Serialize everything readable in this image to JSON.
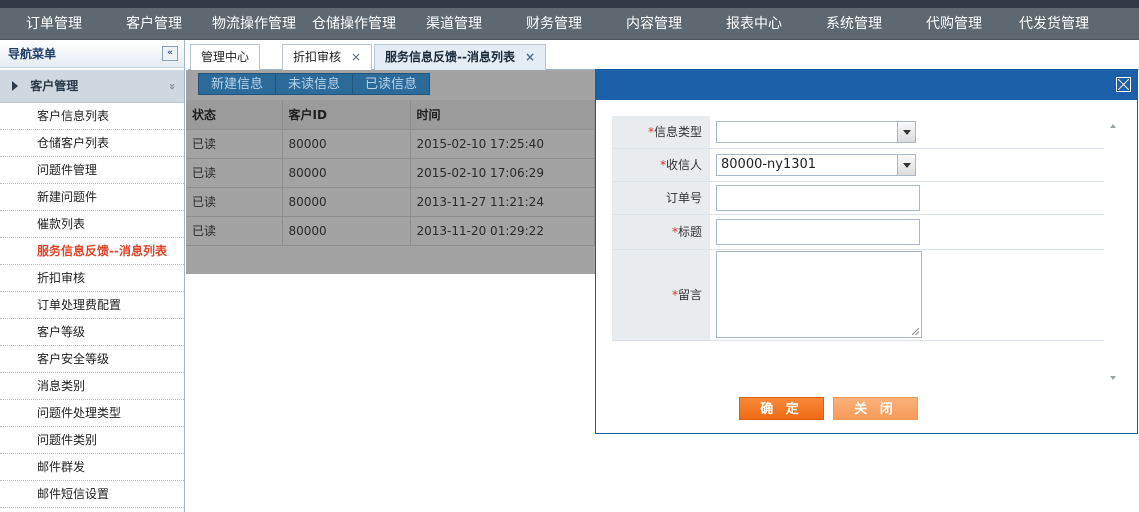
{
  "topnav": [
    "订单管理",
    "客户管理",
    "物流操作管理",
    "仓储操作管理",
    "渠道管理",
    "财务管理",
    "内容管理",
    "报表中心",
    "系统管理",
    "代购管理",
    "代发货管理"
  ],
  "sidebar": {
    "title": "导航菜单",
    "collapse_glyph": "«",
    "section": "客户管理",
    "section_chevron": "»",
    "items": [
      "客户信息列表",
      "仓储客户列表",
      "问题件管理",
      "新建问题件",
      "催款列表",
      "服务信息反馈--消息列表",
      "折扣审核",
      "订单处理费配置",
      "客户等级",
      "客户安全等级",
      "消息类别",
      "问题件处理类型",
      "问题件类别",
      "邮件群发",
      "邮件短信设置"
    ],
    "active_index": 5
  },
  "tabs": [
    {
      "label": "管理中心",
      "closable": false
    },
    {
      "label": "折扣审核",
      "closable": true
    },
    {
      "label": "服务信息反馈--消息列表",
      "closable": true,
      "active": true
    }
  ],
  "tab_close_glyph": "×",
  "toolbar": [
    "新建信息",
    "未读信息",
    "已读信息"
  ],
  "grid": {
    "columns": [
      "状态",
      "客户ID",
      "时间"
    ],
    "rows": [
      [
        "已读",
        "80000",
        "2015-02-10 17:25:40"
      ],
      [
        "已读",
        "80000",
        "2015-02-10 17:06:29"
      ],
      [
        "已读",
        "80000",
        "2013-11-27 11:21:24"
      ],
      [
        "已读",
        "80000",
        "2013-11-20 01:29:22"
      ]
    ]
  },
  "dialog": {
    "required_mark": "*",
    "fields": {
      "info_type": {
        "label": "信息类型",
        "value": ""
      },
      "recipient": {
        "label": "收信人",
        "value": "80000-ny1301"
      },
      "order_no": {
        "label": "订单号",
        "value": ""
      },
      "title": {
        "label": "标题",
        "value": ""
      },
      "message": {
        "label": "留言",
        "value": ""
      }
    },
    "ok_label": "确 定",
    "close_label": "关 闭"
  }
}
